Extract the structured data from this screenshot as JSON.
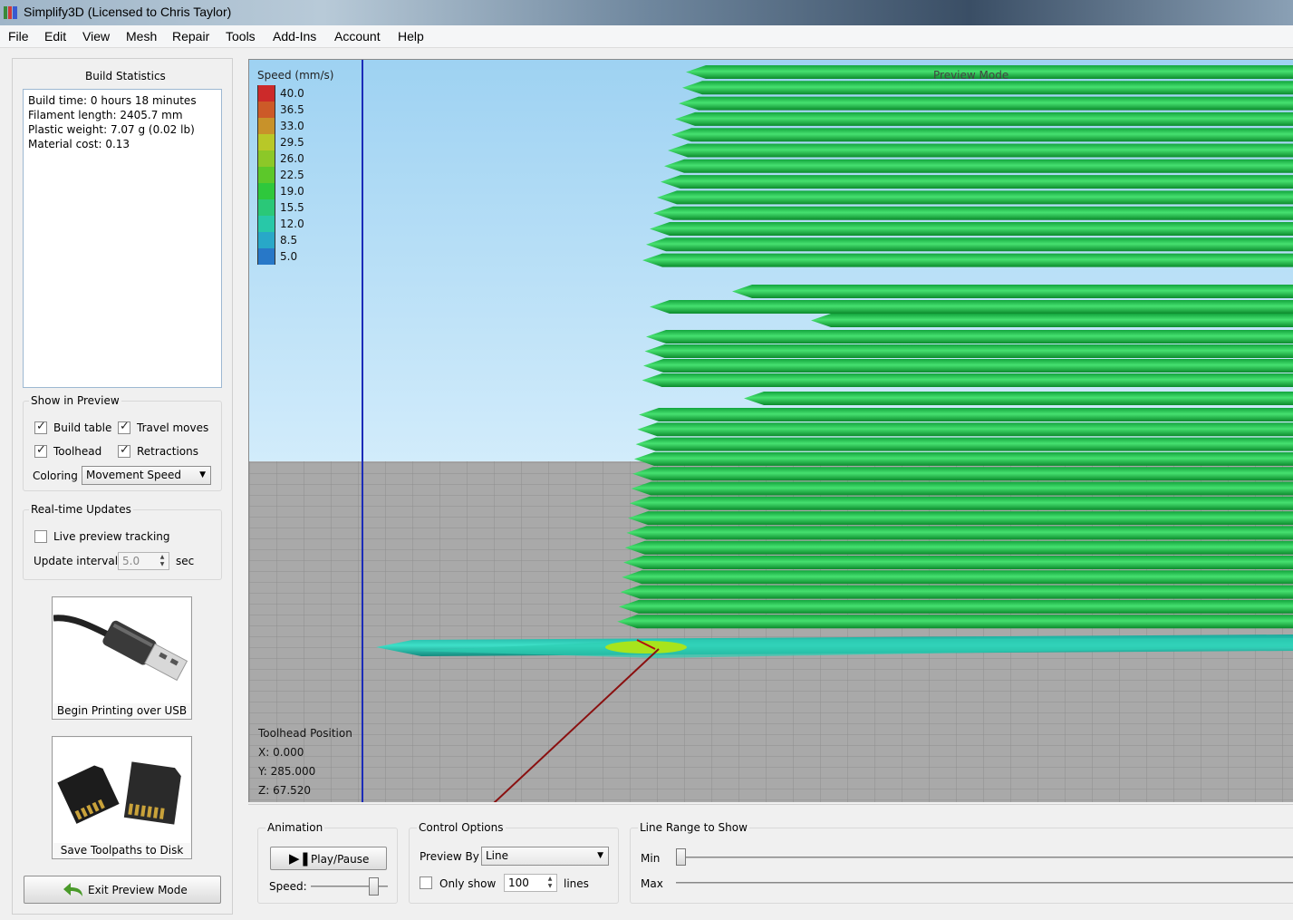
{
  "window": {
    "title": "Simplify3D (Licensed to Chris Taylor)"
  },
  "menu": [
    "File",
    "Edit",
    "View",
    "Mesh",
    "Repair",
    "Tools",
    "Add-Ins",
    "Account",
    "Help"
  ],
  "build_stats": {
    "title": "Build Statistics",
    "lines": [
      "Build time: 0 hours 18 minutes",
      "Filament length: 2405.7 mm",
      "Plastic weight: 7.07 g (0.02 lb)",
      "Material cost: 0.13"
    ]
  },
  "show_in_preview": {
    "title": "Show in Preview",
    "build_table": {
      "label": "Build table",
      "checked": true
    },
    "travel_moves": {
      "label": "Travel moves",
      "checked": true
    },
    "toolhead": {
      "label": "Toolhead",
      "checked": true
    },
    "retractions": {
      "label": "Retractions",
      "checked": true
    },
    "coloring_label": "Coloring",
    "coloring_value": "Movement Speed"
  },
  "realtime": {
    "title": "Real-time Updates",
    "live_tracking": {
      "label": "Live preview tracking",
      "checked": false
    },
    "interval_label": "Update interval",
    "interval_value": "5.0",
    "interval_unit": "sec"
  },
  "buttons": {
    "usb": "Begin Printing over USB",
    "sd": "Save Toolpaths to Disk",
    "exit": "Exit Preview Mode",
    "play": "Play/Pause"
  },
  "viewport": {
    "legend_title": "Speed (mm/s)",
    "legend": [
      {
        "value": "40.0",
        "color": "#cc2a2a"
      },
      {
        "value": "36.5",
        "color": "#cc5a28"
      },
      {
        "value": "33.0",
        "color": "#c8922a"
      },
      {
        "value": "29.5",
        "color": "#b8c828"
      },
      {
        "value": "26.0",
        "color": "#8cc828"
      },
      {
        "value": "22.5",
        "color": "#5cc82a"
      },
      {
        "value": "19.0",
        "color": "#2ec83c"
      },
      {
        "value": "15.5",
        "color": "#2ac878"
      },
      {
        "value": "12.0",
        "color": "#28c8a8"
      },
      {
        "value": "8.5",
        "color": "#28a8c8"
      },
      {
        "value": "5.0",
        "color": "#2878c8"
      }
    ],
    "mode_label": "Preview Mode",
    "toolhead_title": "Toolhead Position",
    "x": "X: 0.000",
    "y": "Y: 285.000",
    "z": "Z: 67.520"
  },
  "animation": {
    "title": "Animation",
    "speed_label": "Speed:"
  },
  "control_options": {
    "title": "Control Options",
    "preview_by_label": "Preview By",
    "preview_by_value": "Line",
    "only_show_label": "Only show",
    "only_show_checked": false,
    "only_show_value": "100",
    "only_show_unit": "lines"
  },
  "line_range": {
    "title": "Line Range to Show",
    "min_label": "Min",
    "max_label": "Max"
  }
}
